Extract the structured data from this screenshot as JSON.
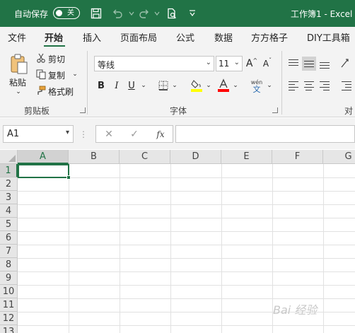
{
  "titlebar": {
    "autosave_label": "自动保存",
    "autosave_state": "关",
    "doc_title": "工作簿1 - Excel"
  },
  "tabs": [
    "文件",
    "开始",
    "插入",
    "页面布局",
    "公式",
    "数据",
    "方方格子",
    "DIY工具箱"
  ],
  "active_tab": "开始",
  "clipboard": {
    "paste_label": "粘贴",
    "cut_label": "剪切",
    "copy_label": "复制",
    "format_painter_label": "格式刷",
    "group_label": "剪贴板"
  },
  "font": {
    "font_name": "等线",
    "font_size": "11",
    "group_label": "字体",
    "bold": "B",
    "italic": "I",
    "underline": "U",
    "grow": "A",
    "shrink": "A",
    "phonetic_top": "wén",
    "phonetic_bottom": "文"
  },
  "alignment": {
    "group_label": "对齐"
  },
  "formula_bar": {
    "name_box": "A1",
    "fx": "fx",
    "value": ""
  },
  "grid": {
    "columns": [
      "A",
      "B",
      "C",
      "D",
      "E",
      "F",
      "G"
    ],
    "rows": [
      "1",
      "2",
      "3",
      "4",
      "5",
      "6",
      "7",
      "8",
      "9",
      "10",
      "11",
      "12",
      "13"
    ],
    "active_cell": "A1"
  },
  "watermark": "Bai 经验",
  "colors": {
    "brand": "#217346",
    "highlight": "#ffff00",
    "font_color": "#ff0000"
  }
}
